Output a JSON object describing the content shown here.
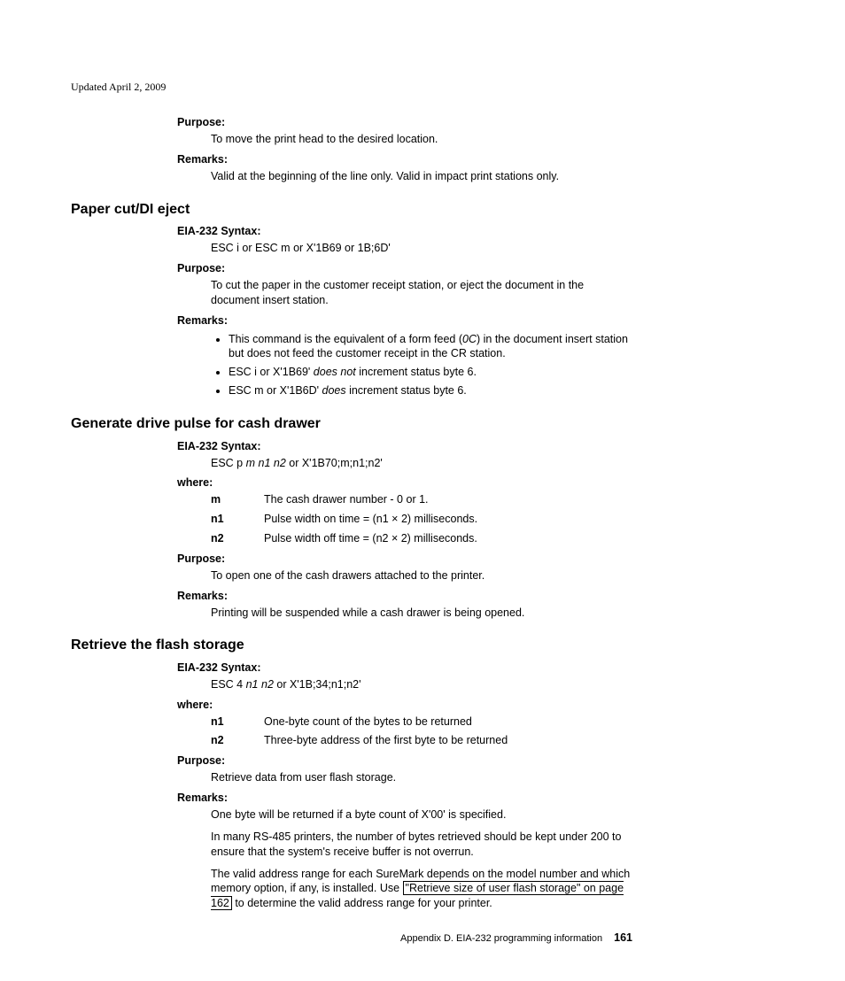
{
  "updated": "Updated April 2, 2009",
  "top": {
    "purpose_label": "Purpose:",
    "purpose_text": "To move the print head to the desired location.",
    "remarks_label": "Remarks:",
    "remarks_text": "Valid at the beginning of the line only. Valid in impact print stations only."
  },
  "s1": {
    "title": "Paper cut/DI eject",
    "syntax_label": "EIA-232 Syntax:",
    "syntax_text": "ESC i or ESC m or X'1B69 or 1B;6D'",
    "purpose_label": "Purpose:",
    "purpose_text": "To cut the paper in the customer receipt station, or eject the document in the document insert station.",
    "remarks_label": "Remarks:",
    "bullets": [
      {
        "pre": "This command is the equivalent of a form feed (",
        "em": "0C",
        "post": ") in the document insert station but does not feed the customer receipt in the CR station."
      },
      {
        "pre": "ESC i or X'1B69' ",
        "em": "does not",
        "post": " increment status byte 6."
      },
      {
        "pre": "ESC m or X'1B6D' ",
        "em": "does",
        "post": " increment status byte 6."
      }
    ]
  },
  "s2": {
    "title": "Generate drive pulse for cash drawer",
    "syntax_label": "EIA-232 Syntax:",
    "syntax_pre": "ESC p ",
    "syntax_em": "m n1 n2",
    "syntax_post": " or X'1B70;m;n1;n2'",
    "where_label": "where:",
    "defs": [
      {
        "term": "m",
        "def": "The cash drawer number - 0 or 1."
      },
      {
        "term": "n1",
        "def": "Pulse width on time = (n1 × 2) milliseconds."
      },
      {
        "term": "n2",
        "def": "Pulse width off time = (n2 × 2) milliseconds."
      }
    ],
    "purpose_label": "Purpose:",
    "purpose_text": "To open one of the cash drawers attached to the printer.",
    "remarks_label": "Remarks:",
    "remarks_text": "Printing will be suspended while a cash drawer is being opened."
  },
  "s3": {
    "title": "Retrieve the flash storage",
    "syntax_label": "EIA-232 Syntax:",
    "syntax_pre": "ESC 4 ",
    "syntax_em": "n1 n2",
    "syntax_post": " or X'1B;34;n1;n2'",
    "where_label": "where:",
    "defs": [
      {
        "term": "n1",
        "def": "One-byte count of the bytes to be returned"
      },
      {
        "term": "n2",
        "def": "Three-byte address of the first byte to be returned"
      }
    ],
    "purpose_label": "Purpose:",
    "purpose_text": "Retrieve data from user flash storage.",
    "remarks_label": "Remarks:",
    "remarks_p1": "One byte will be returned if a byte count of X'00' is specified.",
    "remarks_p2": "In many RS-485 printers, the number of bytes retrieved should be kept under 200 to ensure that the system's receive buffer is not overrun.",
    "remarks_p3_pre": "The valid address range for each SureMark depends on the model number and which memory option, if any, is installed. Use ",
    "remarks_p3_xref": "\"Retrieve size of user flash storage\" on page 162",
    "remarks_p3_post": " to determine the valid address range for your printer."
  },
  "footer": {
    "appendix": "Appendix D. EIA-232 programming information",
    "page": "161"
  }
}
